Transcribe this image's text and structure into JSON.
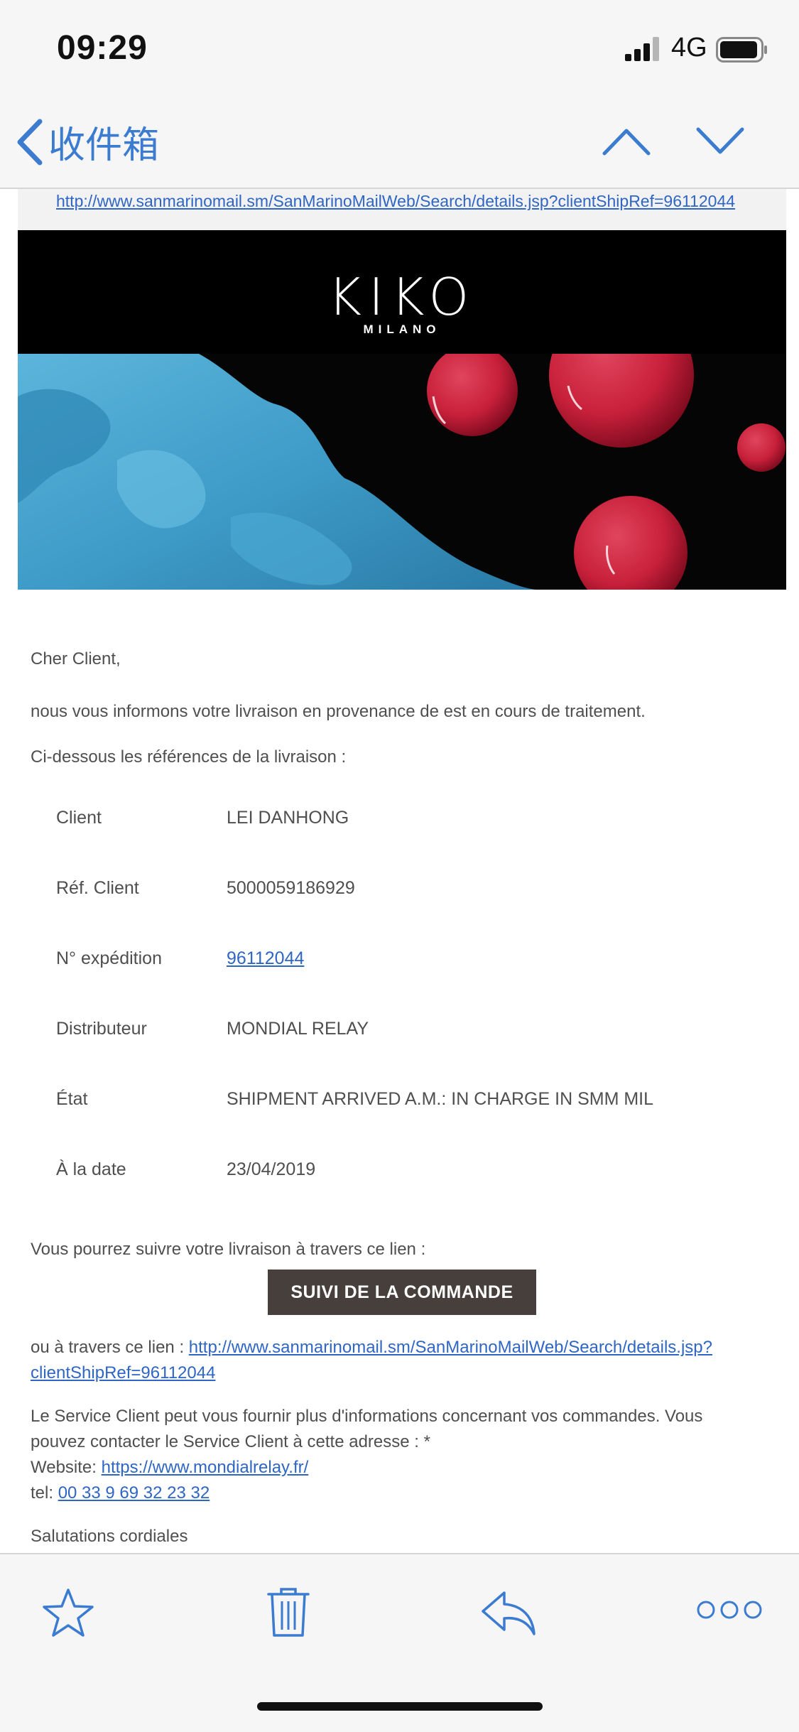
{
  "status_bar": {
    "time": "09:29",
    "network": "4G"
  },
  "nav": {
    "back_label": "收件箱"
  },
  "email": {
    "top_link": "http://www.sanmarinomail.sm/SanMarinoMailWeb/Search/details.jsp?clientShipRef=96112044",
    "brand": {
      "name": "KIKO",
      "sub": "MILANO"
    },
    "greeting": "Cher Client,",
    "intro": "nous vous informons votre livraison en provenance de est en cours de traitement.",
    "refs_heading": "Ci-dessous les références de la livraison :",
    "rows": [
      {
        "label": "Client",
        "value": "LEI DANHONG"
      },
      {
        "label": "Réf. Client",
        "value": "5000059186929"
      },
      {
        "label": "N° expédition",
        "value": "96112044"
      },
      {
        "label": "Distributeur",
        "value": "MONDIAL RELAY"
      },
      {
        "label": "État",
        "value": "SHIPMENT ARRIVED A.M.: IN CHARGE IN SMM MIL"
      },
      {
        "label": "À la date",
        "value": "23/04/2019"
      }
    ],
    "track_text": "Vous pourrez suivre votre livraison à travers ce lien :",
    "cta_label": "SUIVI DE LA COMMANDE",
    "or_link_prefix": "ou à travers ce lien : ",
    "or_link_line1": "http://www.sanmarinomail.sm/SanMarinoMailWeb/Search/details.jsp?",
    "or_link_line2": "clientShipRef=96112044",
    "service_line1": "Le Service Client peut vous fournir plus d'informations concernant vos commandes. Vous",
    "service_line2": "pouvez contacter le Service Client à cette adresse : *",
    "website_label": "Website: ",
    "website_url": "https://www.mondialrelay.fr/",
    "tel_label": "tel: ",
    "tel_number": "00 33 9 69 32 23 32",
    "closing": "Salutations cordiales"
  },
  "toolbar": {
    "icons": [
      "star-icon",
      "trash-icon",
      "reply-icon",
      "more-icon"
    ]
  },
  "colors": {
    "accent": "#3b7bd0",
    "link": "#2f66c4",
    "cta_bg": "#463f3b"
  }
}
